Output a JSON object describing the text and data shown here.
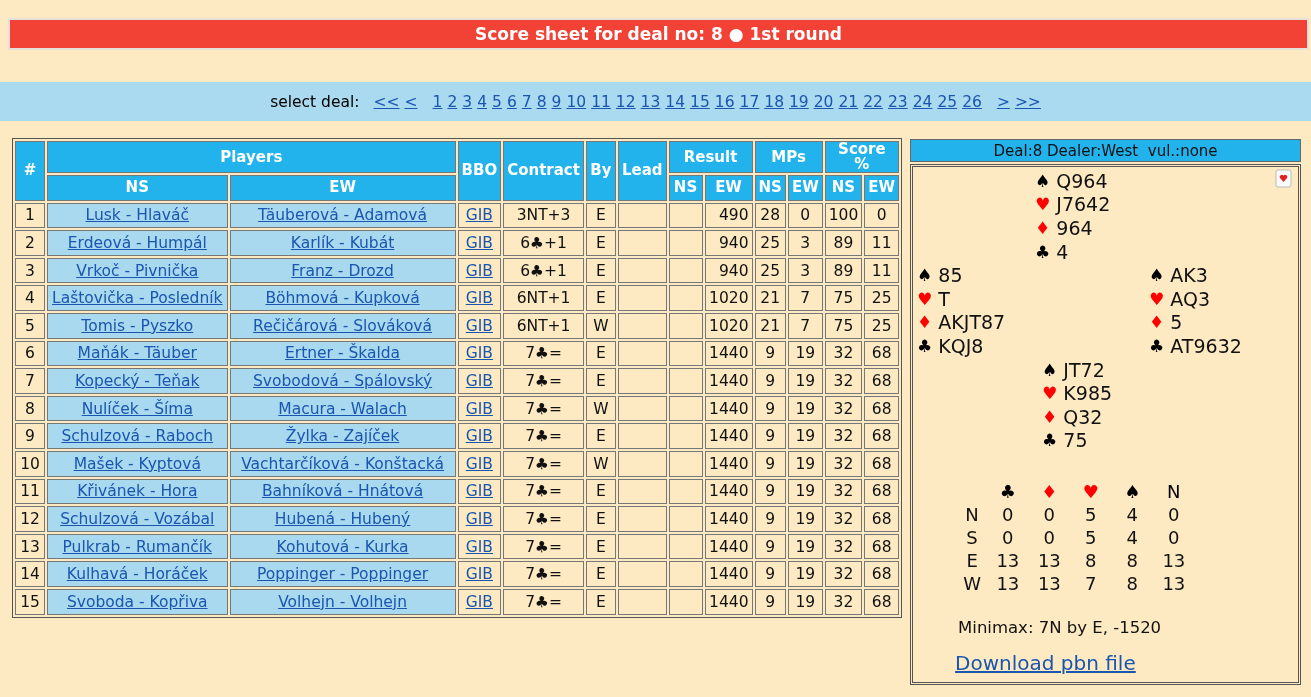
{
  "header": {
    "title": "Score sheet for deal no: 8 ● 1st round"
  },
  "deal_nav": {
    "label": "select deal:",
    "links": [
      "<<",
      "<",
      "1",
      "2",
      "3",
      "4",
      "5",
      "6",
      "7",
      "8",
      "9",
      "10",
      "11",
      "12",
      "13",
      "14",
      "15",
      "16",
      "17",
      "18",
      "19",
      "20",
      "21",
      "22",
      "23",
      "24",
      "25",
      "26",
      ">",
      ">>"
    ]
  },
  "table": {
    "headers": {
      "number": "#",
      "players": "Players",
      "bbo": "BBO",
      "contract": "Contract",
      "by": "By",
      "lead": "Lead",
      "result": "Result",
      "mps": "MPs",
      "score": "Score %"
    },
    "subheaders": [
      "NS",
      "EW",
      "NS",
      "EW",
      "NS",
      "EW",
      "NS",
      "EW"
    ],
    "rows": [
      {
        "no": "1",
        "ns": "Lusk - Hlaváč",
        "ew": "Täuberová - Adamová",
        "bbo": "GIB",
        "contract": "3NT+3",
        "by": "E",
        "result_ew": "490",
        "mp_ns": "28",
        "mp_ew": "0",
        "pct_ns": "100",
        "pct_ew": "0"
      },
      {
        "no": "2",
        "ns": "Erdeová - Humpál",
        "ew": "Karlík - Kubát",
        "bbo": "GIB",
        "contract": "6♣+1",
        "by": "E",
        "result_ew": "940",
        "mp_ns": "25",
        "mp_ew": "3",
        "pct_ns": "89",
        "pct_ew": "11"
      },
      {
        "no": "3",
        "ns": "Vrkoč - Pivnička",
        "ew": "Franz - Drozd",
        "bbo": "GIB",
        "contract": "6♣+1",
        "by": "E",
        "result_ew": "940",
        "mp_ns": "25",
        "mp_ew": "3",
        "pct_ns": "89",
        "pct_ew": "11"
      },
      {
        "no": "4",
        "ns": "Laštovička - Posledník",
        "ew": "Böhmová - Kupková",
        "bbo": "GIB",
        "contract": "6NT+1",
        "by": "E",
        "result_ew": "1020",
        "mp_ns": "21",
        "mp_ew": "7",
        "pct_ns": "75",
        "pct_ew": "25"
      },
      {
        "no": "5",
        "ns": "Tomis - Pyszko",
        "ew": "Rečičárová - Slováková",
        "bbo": "GIB",
        "contract": "6NT+1",
        "by": "W",
        "result_ew": "1020",
        "mp_ns": "21",
        "mp_ew": "7",
        "pct_ns": "75",
        "pct_ew": "25"
      },
      {
        "no": "6",
        "ns": "Maňák - Täuber",
        "ew": "Ertner - Škalda",
        "bbo": "GIB",
        "contract": "7♣=",
        "by": "E",
        "result_ew": "1440",
        "mp_ns": "9",
        "mp_ew": "19",
        "pct_ns": "32",
        "pct_ew": "68"
      },
      {
        "no": "7",
        "ns": "Kopecký - Teňak",
        "ew": "Svobodová - Spálovský",
        "bbo": "GIB",
        "contract": "7♣=",
        "by": "E",
        "result_ew": "1440",
        "mp_ns": "9",
        "mp_ew": "19",
        "pct_ns": "32",
        "pct_ew": "68"
      },
      {
        "no": "8",
        "ns": "Nulíček - Šíma",
        "ew": "Macura - Walach",
        "bbo": "GIB",
        "contract": "7♣=",
        "by": "W",
        "result_ew": "1440",
        "mp_ns": "9",
        "mp_ew": "19",
        "pct_ns": "32",
        "pct_ew": "68"
      },
      {
        "no": "9",
        "ns": "Schulzová - Raboch",
        "ew": "Žylka - Zajíček",
        "bbo": "GIB",
        "contract": "7♣=",
        "by": "E",
        "result_ew": "1440",
        "mp_ns": "9",
        "mp_ew": "19",
        "pct_ns": "32",
        "pct_ew": "68"
      },
      {
        "no": "10",
        "ns": "Mašek - Kyptová",
        "ew": "Vachtarčíková - Konštacká",
        "bbo": "GIB",
        "contract": "7♣=",
        "by": "W",
        "result_ew": "1440",
        "mp_ns": "9",
        "mp_ew": "19",
        "pct_ns": "32",
        "pct_ew": "68"
      },
      {
        "no": "11",
        "ns": "Křivánek - Hora",
        "ew": "Bahníková - Hnátová",
        "bbo": "GIB",
        "contract": "7♣=",
        "by": "E",
        "result_ew": "1440",
        "mp_ns": "9",
        "mp_ew": "19",
        "pct_ns": "32",
        "pct_ew": "68"
      },
      {
        "no": "12",
        "ns": "Schulzová - Vozábal",
        "ew": "Hubená - Hubený",
        "bbo": "GIB",
        "contract": "7♣=",
        "by": "E",
        "result_ew": "1440",
        "mp_ns": "9",
        "mp_ew": "19",
        "pct_ns": "32",
        "pct_ew": "68"
      },
      {
        "no": "13",
        "ns": "Pulkrab - Rumančík",
        "ew": "Kohutová - Kurka",
        "bbo": "GIB",
        "contract": "7♣=",
        "by": "E",
        "result_ew": "1440",
        "mp_ns": "9",
        "mp_ew": "19",
        "pct_ns": "32",
        "pct_ew": "68"
      },
      {
        "no": "14",
        "ns": "Kulhavá - Horáček",
        "ew": "Poppinger - Poppinger",
        "bbo": "GIB",
        "contract": "7♣=",
        "by": "E",
        "result_ew": "1440",
        "mp_ns": "9",
        "mp_ew": "19",
        "pct_ns": "32",
        "pct_ew": "68"
      },
      {
        "no": "15",
        "ns": "Svoboda - Kopřiva",
        "ew": "Volhejn - Volhejn",
        "bbo": "GIB",
        "contract": "7♣=",
        "by": "E",
        "result_ew": "1440",
        "mp_ns": "9",
        "mp_ew": "19",
        "pct_ns": "32",
        "pct_ew": "68"
      }
    ]
  },
  "deal_panel": {
    "title": "Deal:8 Dealer:West  vul.:none",
    "hands": {
      "north": [
        {
          "suit": "♠",
          "color": "#000000",
          "cards": "Q964"
        },
        {
          "suit": "♥",
          "color": "#ff0000",
          "cards": "J7642"
        },
        {
          "suit": "♦",
          "color": "#ff0000",
          "cards": "964"
        },
        {
          "suit": "♣",
          "color": "#000000",
          "cards": "4"
        }
      ],
      "west": [
        {
          "suit": "♠",
          "color": "#000000",
          "cards": "85"
        },
        {
          "suit": "♥",
          "color": "#ff0000",
          "cards": "T"
        },
        {
          "suit": "♦",
          "color": "#ff0000",
          "cards": "AKJT87"
        },
        {
          "suit": "♣",
          "color": "#000000",
          "cards": "KQJ8"
        }
      ],
      "east": [
        {
          "suit": "♠",
          "color": "#000000",
          "cards": "AK3"
        },
        {
          "suit": "♥",
          "color": "#ff0000",
          "cards": "AQ3"
        },
        {
          "suit": "♦",
          "color": "#ff0000",
          "cards": "5"
        },
        {
          "suit": "♣",
          "color": "#000000",
          "cards": "AT9632"
        }
      ],
      "south": [
        {
          "suit": "♠",
          "color": "#000000",
          "cards": "JT72"
        },
        {
          "suit": "♥",
          "color": "#ff0000",
          "cards": "K985"
        },
        {
          "suit": "♦",
          "color": "#ff0000",
          "cards": "Q32"
        },
        {
          "suit": "♣",
          "color": "#000000",
          "cards": "75"
        }
      ]
    },
    "double_dummy": {
      "columns": [
        {
          "label": "♣",
          "color": "#000000"
        },
        {
          "label": "♦",
          "color": "#ff0000"
        },
        {
          "label": "♥",
          "color": "#ff0000"
        },
        {
          "label": "♠",
          "color": "#000000"
        },
        {
          "label": "N",
          "color": "#000000"
        }
      ],
      "rows": [
        {
          "seat": "N",
          "tricks": [
            "0",
            "0",
            "5",
            "4",
            "0"
          ]
        },
        {
          "seat": "S",
          "tricks": [
            "0",
            "0",
            "5",
            "4",
            "0"
          ]
        },
        {
          "seat": "E",
          "tricks": [
            "13",
            "13",
            "8",
            "8",
            "13"
          ]
        },
        {
          "seat": "W",
          "tricks": [
            "13",
            "13",
            "7",
            "8",
            "13"
          ]
        }
      ]
    },
    "minimax": "Minimax: 7N by E, -1520",
    "download_link": "Download pbn file"
  }
}
